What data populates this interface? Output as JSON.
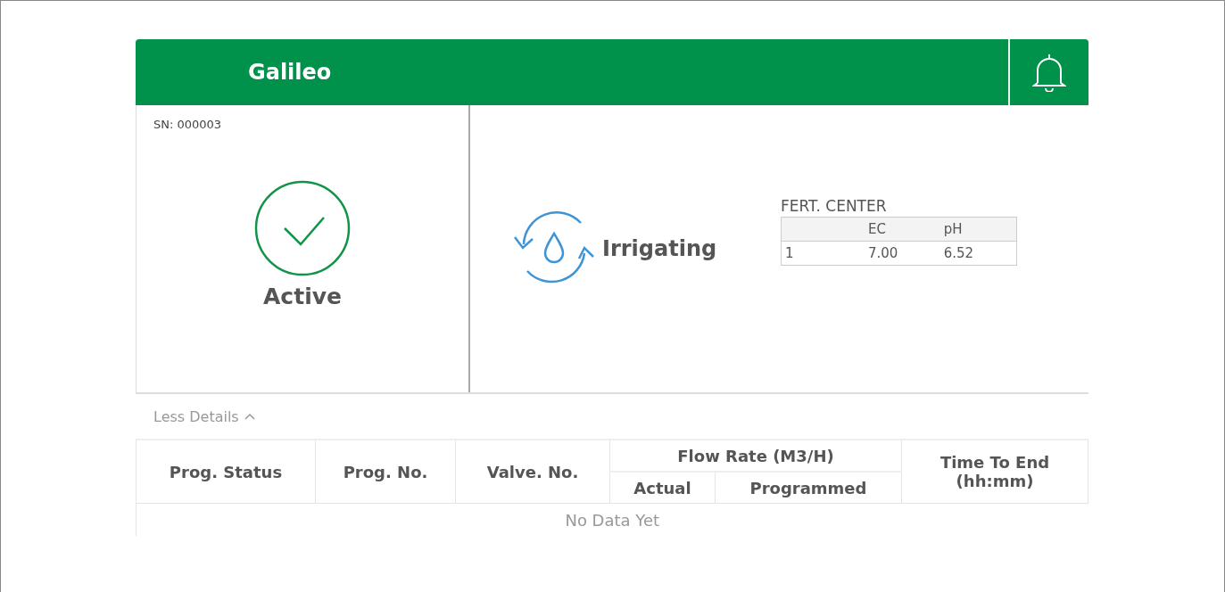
{
  "header": {
    "title": "Galileo"
  },
  "device": {
    "serial": "SN: 000003",
    "status": {
      "kind": "active",
      "label": "Active"
    }
  },
  "activity": {
    "kind": "irrigating",
    "label": "Irrigating"
  },
  "fert_center": {
    "title": "FERT. CENTER",
    "columns": [
      "",
      "EC",
      "pH"
    ],
    "rows": [
      [
        "1",
        "7.00",
        "6.52"
      ]
    ]
  },
  "details_toggle": {
    "label": "Less Details",
    "expanded": true
  },
  "program_table": {
    "columns": [
      "Prog. Status",
      "Prog. No.",
      "Valve. No."
    ],
    "flow_group": "Flow Rate (M3/H)",
    "flow_columns": [
      "Actual",
      "Programmed"
    ],
    "last_column": [
      "Time To End",
      "(hh:mm)"
    ],
    "empty_message": "No Data Yet"
  }
}
